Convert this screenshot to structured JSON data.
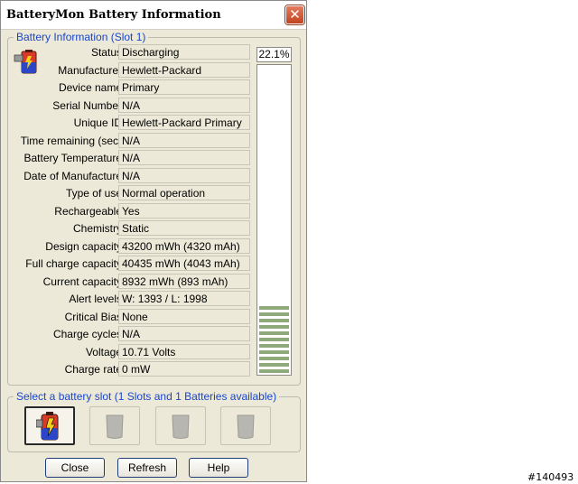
{
  "window": {
    "title": "BatteryMon Battery Information",
    "close_glyph": "✕"
  },
  "battery_group": {
    "label": "Battery Information (Slot 1)",
    "icon": "battery-slot-icon",
    "percent": "22.1%",
    "charge_fraction": 0.221,
    "gauge_color": "#8ea97a",
    "fields": [
      {
        "label": "Status",
        "value": "Discharging"
      },
      {
        "label": "Manufacturer",
        "value": "Hewlett-Packard"
      },
      {
        "label": "Device name",
        "value": "Primary"
      },
      {
        "label": "Serial Number",
        "value": "N/A"
      },
      {
        "label": "Unique ID",
        "value": "Hewlett-Packard Primary"
      },
      {
        "label": "Time remaining (sec)",
        "value": "N/A"
      },
      {
        "label": "Battery Temperature",
        "value": "N/A"
      },
      {
        "label": "Date of Manufacture",
        "value": "N/A"
      },
      {
        "label": "Type of use",
        "value": "Normal operation"
      },
      {
        "label": "Rechargeable",
        "value": "Yes"
      },
      {
        "label": "Chemistry",
        "value": "Static"
      },
      {
        "label": "Design capacity",
        "value": "43200 mWh (4320 mAh)"
      },
      {
        "label": "Full charge capacity",
        "value": "40435 mWh (4043 mAh)"
      },
      {
        "label": "Current capacity",
        "value": "8932 mWh (893 mAh)"
      },
      {
        "label": "Alert levels",
        "value": "W: 1393 / L: 1998"
      },
      {
        "label": "Critical Bias",
        "value": "None"
      },
      {
        "label": "Charge cycles",
        "value": "N/A"
      },
      {
        "label": "Voltage",
        "value": "10.71 Volts"
      },
      {
        "label": "Charge rate",
        "value": "0 mW"
      }
    ]
  },
  "slot_group": {
    "label": "Select a battery slot (1 Slots and 1 Batteries available)",
    "slots": [
      {
        "name": "battery-slot-1-icon",
        "active": true
      },
      {
        "name": "battery-slot-2-icon",
        "active": false
      },
      {
        "name": "battery-slot-3-icon",
        "active": false
      },
      {
        "name": "battery-slot-4-icon",
        "active": false
      }
    ]
  },
  "buttons": {
    "close": "Close",
    "refresh": "Refresh",
    "help": "Help"
  },
  "watermark": "#140493"
}
